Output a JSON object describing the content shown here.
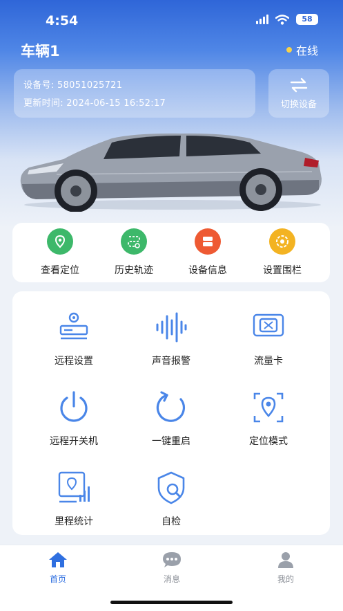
{
  "status_bar": {
    "time": "4:54",
    "battery": "58"
  },
  "header": {
    "title": "车辆1",
    "status": "在线"
  },
  "device": {
    "id_line": "设备号: 58051025721",
    "updated_line": "更新时间: 2024-06-15 16:52:17"
  },
  "switch_device": {
    "label": "切换设备",
    "icon": "swap-arrows-icon"
  },
  "quick_actions": [
    {
      "label": "查看定位",
      "icon": "location-pin-icon",
      "color": "#3db86a"
    },
    {
      "label": "历史轨迹",
      "icon": "route-history-icon",
      "color": "#3db86a"
    },
    {
      "label": "设备信息",
      "icon": "device-info-icon",
      "color": "#ee5a33"
    },
    {
      "label": "设置围栏",
      "icon": "geofence-icon",
      "color": "#f3b322"
    }
  ],
  "functions": [
    {
      "label": "远程设置",
      "icon": "remote-settings-icon"
    },
    {
      "label": "声音报警",
      "icon": "sound-wave-icon"
    },
    {
      "label": "流量卡",
      "icon": "sim-card-icon"
    },
    {
      "label": "远程开关机",
      "icon": "power-icon"
    },
    {
      "label": "一键重启",
      "icon": "restart-icon"
    },
    {
      "label": "定位模式",
      "icon": "locate-mode-icon"
    },
    {
      "label": "里程统计",
      "icon": "mileage-stats-icon"
    },
    {
      "label": "自检",
      "icon": "self-check-icon"
    }
  ],
  "tabs": [
    {
      "label": "首页",
      "icon": "home-icon",
      "active": true
    },
    {
      "label": "消息",
      "icon": "message-icon",
      "active": false
    },
    {
      "label": "我的",
      "icon": "profile-icon",
      "active": false
    }
  ],
  "colors": {
    "accent": "#2f6fe0",
    "icon_blue": "#4a86e8"
  }
}
